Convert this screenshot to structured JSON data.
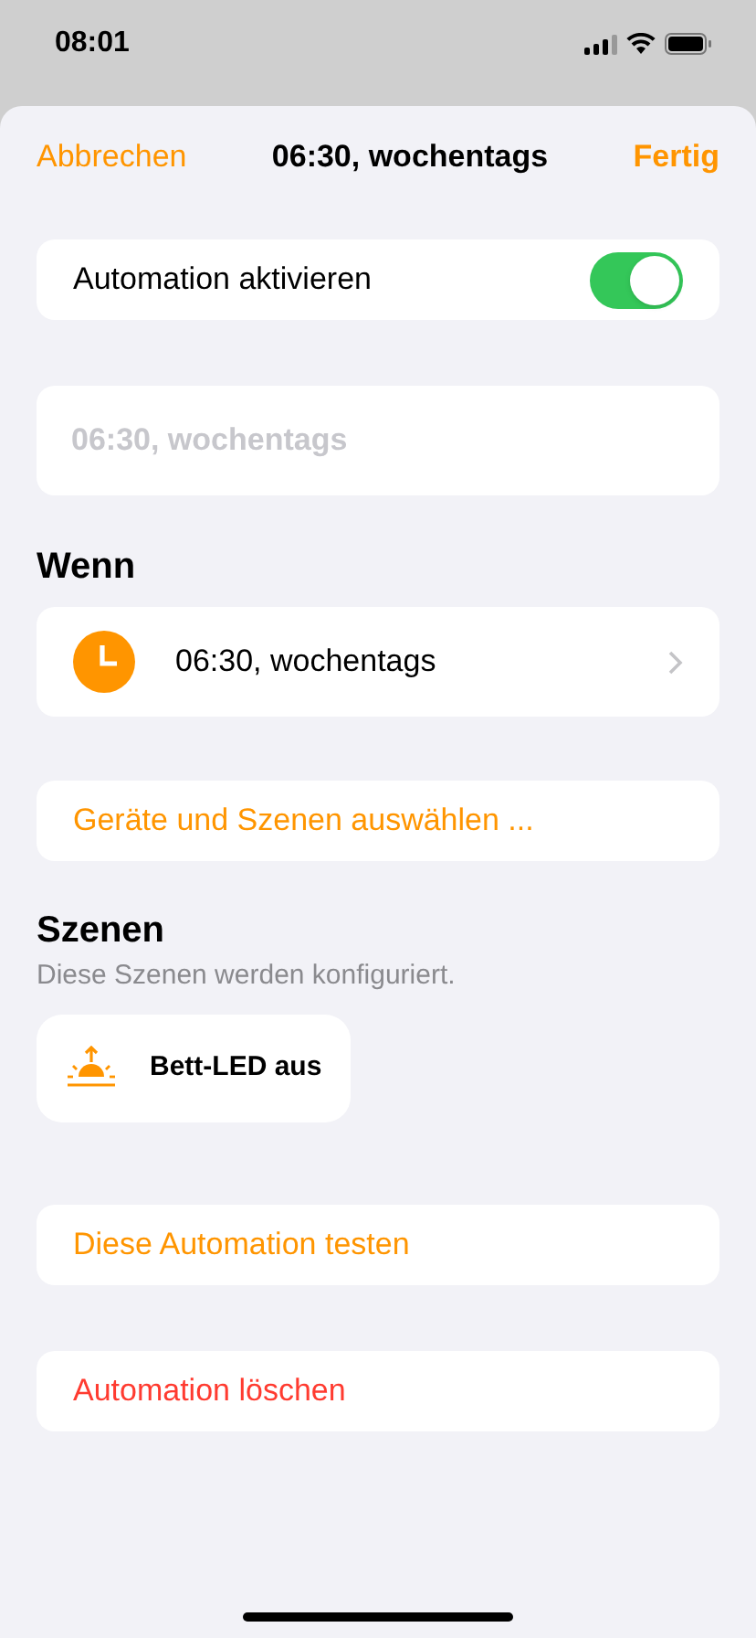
{
  "status_bar": {
    "time": "08:01"
  },
  "nav": {
    "cancel": "Abbrechen",
    "title": "06:30, wochentags",
    "done": "Fertig"
  },
  "enable_row": {
    "label": "Automation aktivieren",
    "on": true
  },
  "name_field": {
    "placeholder": "06:30, wochentags"
  },
  "trigger_section": {
    "heading": "Wenn",
    "trigger": {
      "label": "06:30, wochentags"
    }
  },
  "select_action": "Geräte und Szenen auswählen ...",
  "scenes_section": {
    "heading": "Szenen",
    "subtitle": "Diese Szenen werden konfiguriert.",
    "scenes": [
      {
        "label": "Bett-LED aus"
      }
    ]
  },
  "actions": [
    {
      "label": "Diese Automation testen",
      "kind": "normal"
    },
    {
      "label": "Automation löschen",
      "kind": "destructive"
    }
  ]
}
